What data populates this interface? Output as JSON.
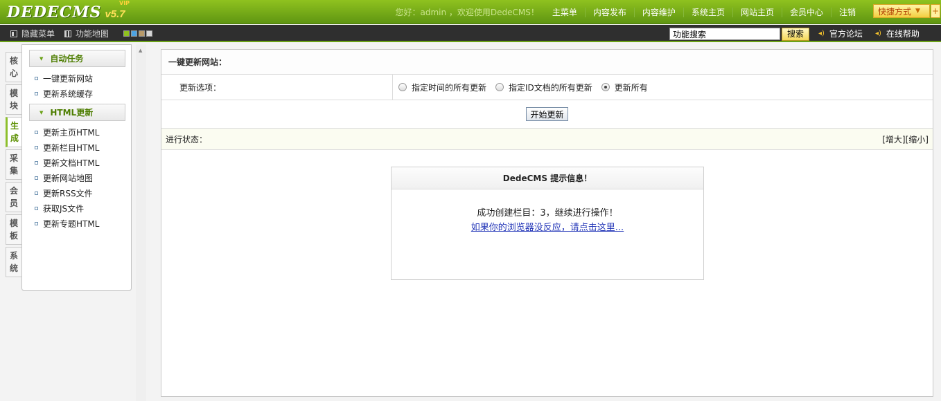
{
  "header": {
    "logo_text": "DEDECMS",
    "logo_version": "v5.7",
    "logo_badge": "VIP",
    "welcome": "您好：admin ，欢迎使用DedeCMS！",
    "nav": [
      "主菜单",
      "内容发布",
      "内容维护",
      "系统主页",
      "网站主页",
      "会员中心",
      "注销"
    ],
    "quick_menu": "快捷方式",
    "quick_plus": "+"
  },
  "toolbar": {
    "hide_menu": "隐藏菜单",
    "site_map": "功能地图",
    "search_value": "功能搜索",
    "search_button": "搜索",
    "forum": "官方论坛",
    "help": "在线帮助",
    "theme_colors": [
      "#8fc21f",
      "#4da3e3",
      "#b89a6a",
      "#d6d6d6"
    ]
  },
  "vtabs": [
    {
      "top": "核",
      "bottom": "心"
    },
    {
      "top": "模",
      "bottom": "块"
    },
    {
      "top": "生",
      "bottom": "成"
    },
    {
      "top": "采",
      "bottom": "集"
    },
    {
      "top": "会",
      "bottom": "员"
    },
    {
      "top": "模",
      "bottom": "板"
    },
    {
      "top": "系",
      "bottom": "统"
    }
  ],
  "menu": {
    "group1_title": "自动任务",
    "group1_items": [
      "一键更新网站",
      "更新系统缓存"
    ],
    "group2_title": "HTML更新",
    "group2_items": [
      "更新主页HTML",
      "更新栏目HTML",
      "更新文档HTML",
      "更新网站地图",
      "更新RSS文件",
      "获取JS文件",
      "更新专题HTML"
    ]
  },
  "main": {
    "title": "一键更新网站：",
    "option_label": "更新选项：",
    "radios": [
      {
        "label": "指定时间的所有更新",
        "checked": false
      },
      {
        "label": "指定ID文档的所有更新",
        "checked": false
      },
      {
        "label": "更新所有",
        "checked": true
      }
    ],
    "start_button": "开始更新",
    "status_label": "进行状态：",
    "enlarge": "[增大]",
    "shrink": "[缩小]",
    "message": {
      "title": "DedeCMS 提示信息！",
      "text": "成功创建栏目：3，继续进行操作！",
      "link": "如果你的浏览器没反应，请点击这里..."
    }
  }
}
